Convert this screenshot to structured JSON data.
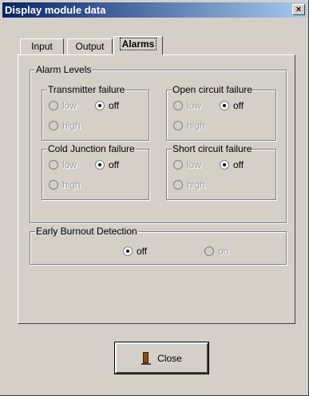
{
  "window": {
    "title": "Display module data",
    "close_glyph": "×"
  },
  "tabs": [
    {
      "label": "Input"
    },
    {
      "label": "Output"
    },
    {
      "label": "Alarms"
    }
  ],
  "alarm_levels": {
    "label": "Alarm Levels",
    "groups": [
      {
        "label": "Transmitter failure",
        "options": [
          "low",
          "off",
          "high"
        ],
        "selected": "off"
      },
      {
        "label": "Open circuit failure",
        "options": [
          "low",
          "off",
          "high"
        ],
        "selected": "off"
      },
      {
        "label": "Cold Junction failure",
        "options": [
          "low",
          "off",
          "high"
        ],
        "selected": "off"
      },
      {
        "label": "Short circuit failure",
        "options": [
          "low",
          "off",
          "high"
        ],
        "selected": "off"
      }
    ]
  },
  "burnout": {
    "label": "Early Burnout Detection",
    "options": [
      "off",
      "on"
    ],
    "selected": "off"
  },
  "close_button": {
    "label": "Close"
  }
}
